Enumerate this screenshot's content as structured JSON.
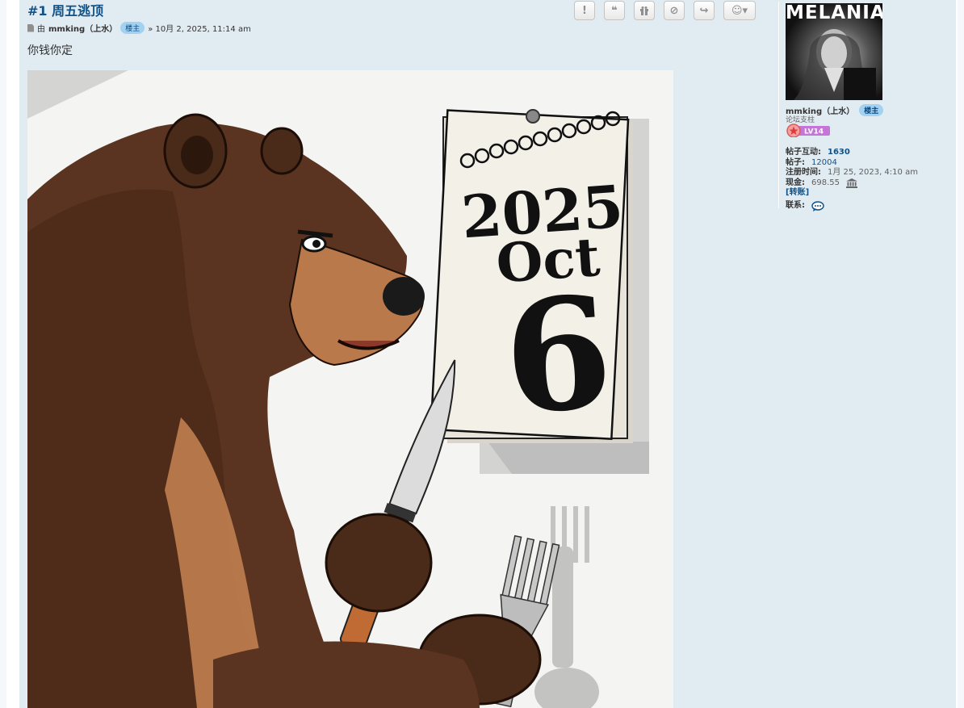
{
  "post": {
    "title": "#1 周五逃顶",
    "by": "由",
    "author": "mmking（上水）",
    "author_badge": "楼主",
    "date": "» 10月 2, 2025, 11:14 am",
    "content": "你钱你定"
  },
  "actions": [
    {
      "name": "report-button",
      "icon": "!"
    },
    {
      "name": "quote-button",
      "icon": "❝"
    },
    {
      "name": "gift-button",
      "icon": "🎁"
    },
    {
      "name": "block-button",
      "icon": "⊘"
    },
    {
      "name": "share-button",
      "icon": "↪"
    },
    {
      "name": "emoji-button",
      "icon": "☺▾"
    }
  ],
  "image": {
    "calendar_year": "2025",
    "calendar_month": "Oct",
    "calendar_day": "6"
  },
  "profile": {
    "avatar_text": "MELANIA",
    "name": "mmking（上水）",
    "badge": "楼主",
    "rank": "论坛支柱",
    "level": "LV14",
    "interactions_label": "帖子互动:",
    "interactions": "1630",
    "posts_label": "帖子:",
    "posts": "12004",
    "joined_label": "注册时间:",
    "joined": "1月 25, 2023, 4:10 am",
    "cash_label": "现金:",
    "cash": "698.55",
    "transfer": "[转账]",
    "contact_label": "联系:"
  }
}
